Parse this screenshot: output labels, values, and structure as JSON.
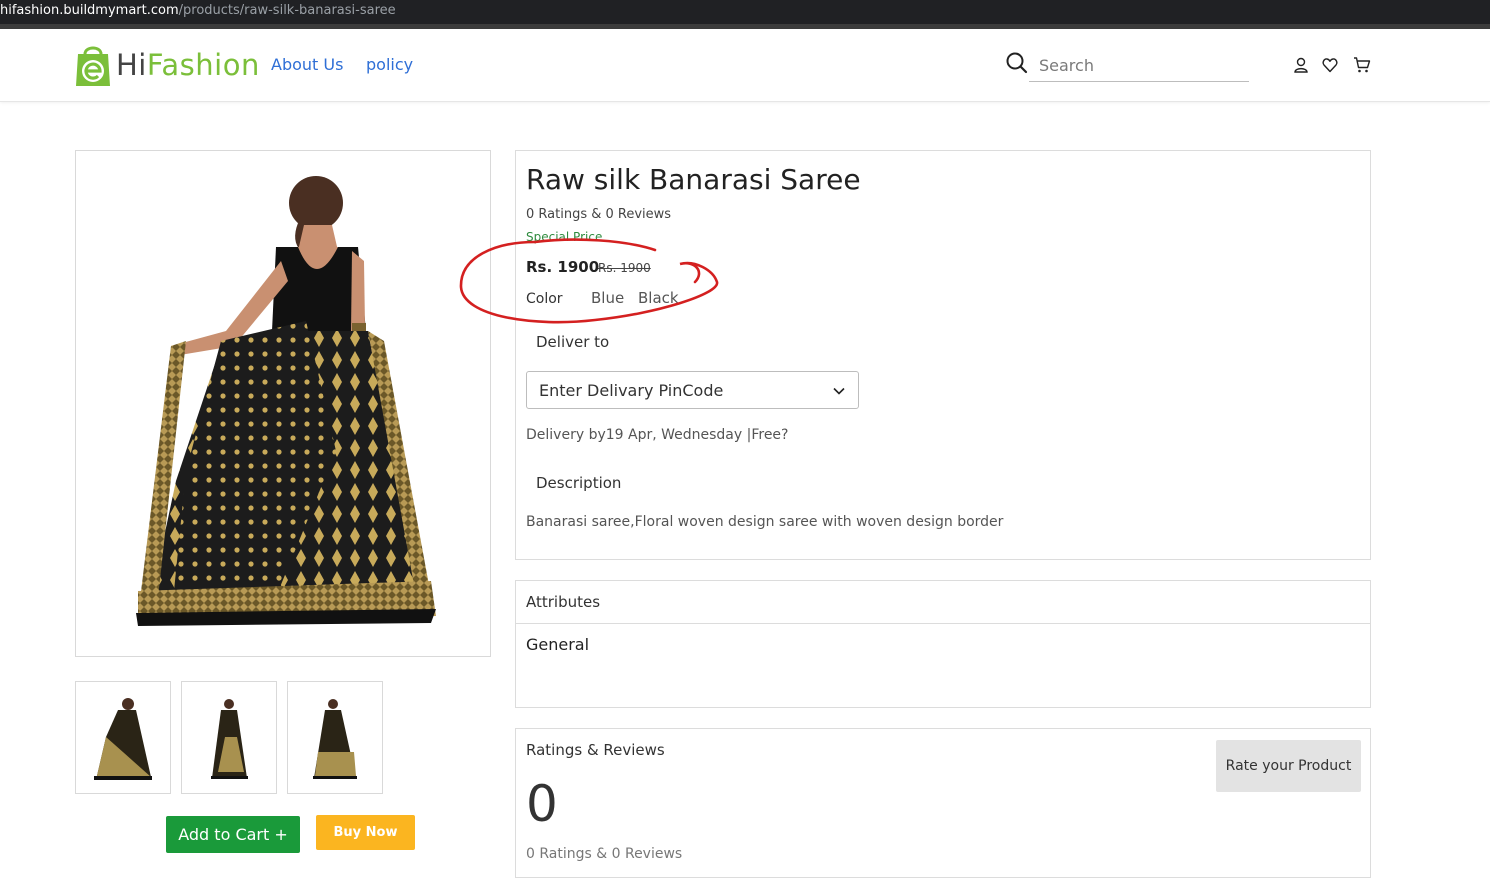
{
  "browser": {
    "url_host": "hifashion.buildmymart.com",
    "url_path": "/products/raw-silk-banarasi-saree"
  },
  "header": {
    "logo_text_hi": "Hi",
    "logo_text_fashion": "Fashion",
    "nav": [
      {
        "label": "About Us"
      },
      {
        "label": "policy"
      }
    ],
    "search_placeholder": "Search",
    "icons": [
      "user-icon",
      "heart-icon",
      "cart-icon"
    ]
  },
  "product": {
    "title": "Raw silk Banarasi Saree",
    "ratings_line": "0 Ratings & 0 Reviews",
    "special_label": "Special Price",
    "price": "Rs. 1900",
    "mrp": "Rs. 1900",
    "color_label": "Color",
    "colors": [
      "Blue",
      "Black"
    ],
    "deliver_label": "Deliver to",
    "pincode_placeholder": "Enter Delivary PinCode",
    "delivery_by": "Delivery by19 Apr, Wednesday |Free?",
    "description_label": "Description",
    "description_text": "Banarasi saree,Floral woven design saree with woven design border",
    "add_to_cart_label": "Add to Cart +",
    "buy_now_label": "Buy Now",
    "thumbnail_count": 3
  },
  "attributes": {
    "title": "Attributes",
    "group": "General"
  },
  "ratings": {
    "title": "Ratings & Reviews",
    "rate_button": "Rate your Product",
    "average": "0",
    "summary": "0 Ratings & 0 Reviews"
  },
  "colors": {
    "brand_green": "#7bbf3a",
    "nav_blue": "#2f6fd6",
    "cart_green": "#1a9a3a",
    "buy_yellow": "#fbb520",
    "annotation_red": "#d42020"
  }
}
